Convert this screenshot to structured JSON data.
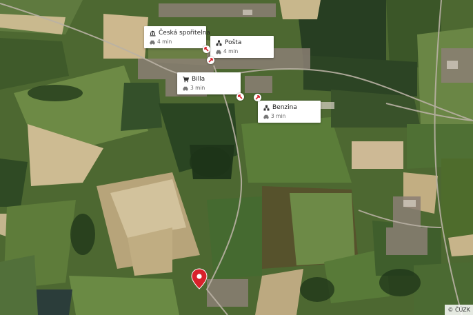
{
  "map": {
    "imagery": "aerial orthophoto",
    "accent_color": "#d8212b"
  },
  "pois": [
    {
      "name": "Česká spořitelna",
      "time": "4 min",
      "icon": "bank-icon",
      "mode": "car-icon"
    },
    {
      "name": "Pošta",
      "time": "4 min",
      "icon": "post-office-icon",
      "mode": "car-icon"
    },
    {
      "name": "Billa",
      "time": "3 min",
      "icon": "shopping-cart-icon",
      "mode": "car-icon"
    },
    {
      "name": "Benzina",
      "time": "3 min",
      "icon": "post-office-icon",
      "mode": "car-icon"
    }
  ],
  "marker": {
    "icon": "location-pin-icon",
    "color": "#d8212b"
  },
  "attribution": "© ČÚZK"
}
